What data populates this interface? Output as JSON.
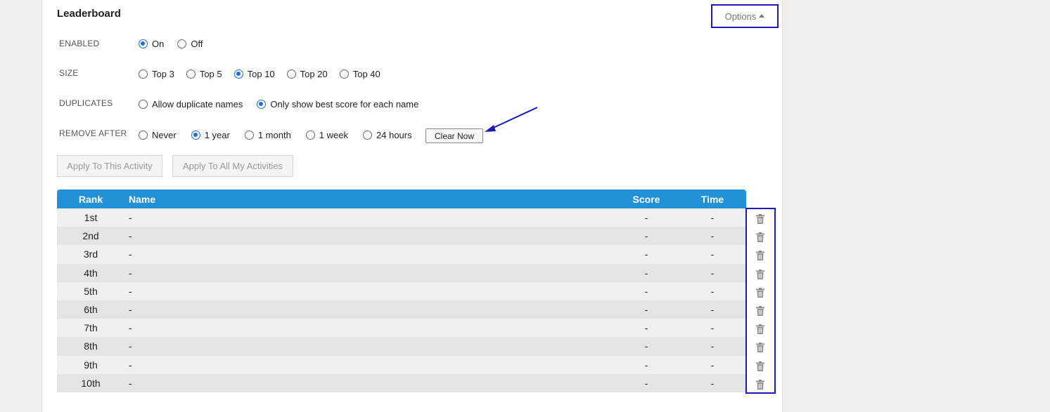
{
  "title": "Leaderboard",
  "options_label": "Options",
  "settings": {
    "enabled": {
      "label": "ENABLED",
      "options": [
        "On",
        "Off"
      ],
      "selected": "On"
    },
    "size": {
      "label": "SIZE",
      "options": [
        "Top 3",
        "Top 5",
        "Top 10",
        "Top 20",
        "Top 40"
      ],
      "selected": "Top 10"
    },
    "duplicates": {
      "label": "DUPLICATES",
      "options": [
        "Allow duplicate names",
        "Only show best score for each name"
      ],
      "selected": "Only show best score for each name"
    },
    "remove_after": {
      "label": "REMOVE AFTER",
      "options": [
        "Never",
        "1 year",
        "1 month",
        "1 week",
        "24 hours"
      ],
      "selected": "1 year"
    }
  },
  "clear_now_label": "Clear Now",
  "apply_this_label": "Apply To This Activity",
  "apply_all_label": "Apply To All My Activities",
  "table": {
    "headers": {
      "rank": "Rank",
      "name": "Name",
      "score": "Score",
      "time": "Time"
    },
    "rows": [
      {
        "rank": "1st",
        "name": "-",
        "score": "-",
        "time": "-"
      },
      {
        "rank": "2nd",
        "name": "-",
        "score": "-",
        "time": "-"
      },
      {
        "rank": "3rd",
        "name": "-",
        "score": "-",
        "time": "-"
      },
      {
        "rank": "4th",
        "name": "-",
        "score": "-",
        "time": "-"
      },
      {
        "rank": "5th",
        "name": "-",
        "score": "-",
        "time": "-"
      },
      {
        "rank": "6th",
        "name": "-",
        "score": "-",
        "time": "-"
      },
      {
        "rank": "7th",
        "name": "-",
        "score": "-",
        "time": "-"
      },
      {
        "rank": "8th",
        "name": "-",
        "score": "-",
        "time": "-"
      },
      {
        "rank": "9th",
        "name": "-",
        "score": "-",
        "time": "-"
      },
      {
        "rank": "10th",
        "name": "-",
        "score": "-",
        "time": "-"
      }
    ]
  },
  "colors": {
    "header_bg": "#2291d6",
    "radio_checked": "#1a6fd4",
    "annotation": "#1a1ab8"
  },
  "icons": {
    "row_delete": "trash-icon",
    "options_caret": "caret-up-icon",
    "annotation_arrow": "arrow-icon"
  }
}
